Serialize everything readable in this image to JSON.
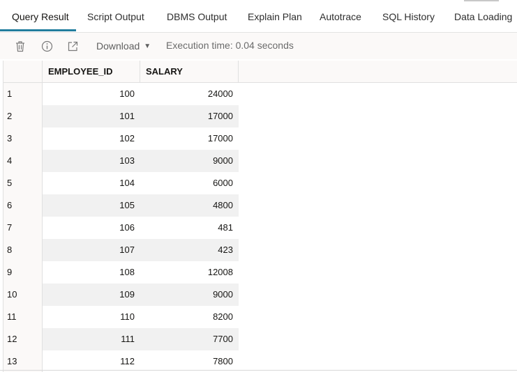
{
  "tabs": [
    {
      "label": "Query Result",
      "active": true
    },
    {
      "label": "Script Output"
    },
    {
      "label": "DBMS Output"
    },
    {
      "label": "Explain Plan"
    },
    {
      "label": "Autotrace"
    },
    {
      "label": "SQL History"
    },
    {
      "label": "Data Loading"
    }
  ],
  "toolbar": {
    "icons": [
      "trash-icon",
      "info-icon",
      "open-external-icon"
    ],
    "download_label": "Download",
    "execution_time": "Execution time: 0.04 seconds"
  },
  "table": {
    "columns": [
      "EMPLOYEE_ID",
      "SALARY"
    ],
    "rows": [
      {
        "n": "1",
        "employee_id": "100",
        "salary": "24000"
      },
      {
        "n": "2",
        "employee_id": "101",
        "salary": "17000"
      },
      {
        "n": "3",
        "employee_id": "102",
        "salary": "17000"
      },
      {
        "n": "4",
        "employee_id": "103",
        "salary": "9000"
      },
      {
        "n": "5",
        "employee_id": "104",
        "salary": "6000"
      },
      {
        "n": "6",
        "employee_id": "105",
        "salary": "4800"
      },
      {
        "n": "7",
        "employee_id": "106",
        "salary": "481"
      },
      {
        "n": "8",
        "employee_id": "107",
        "salary": "423"
      },
      {
        "n": "9",
        "employee_id": "108",
        "salary": "12008"
      },
      {
        "n": "10",
        "employee_id": "109",
        "salary": "9000"
      },
      {
        "n": "11",
        "employee_id": "110",
        "salary": "8200"
      },
      {
        "n": "12",
        "employee_id": "111",
        "salary": "7700"
      },
      {
        "n": "13",
        "employee_id": "112",
        "salary": "7800"
      }
    ]
  },
  "colors": {
    "accent": "#227e9e"
  }
}
